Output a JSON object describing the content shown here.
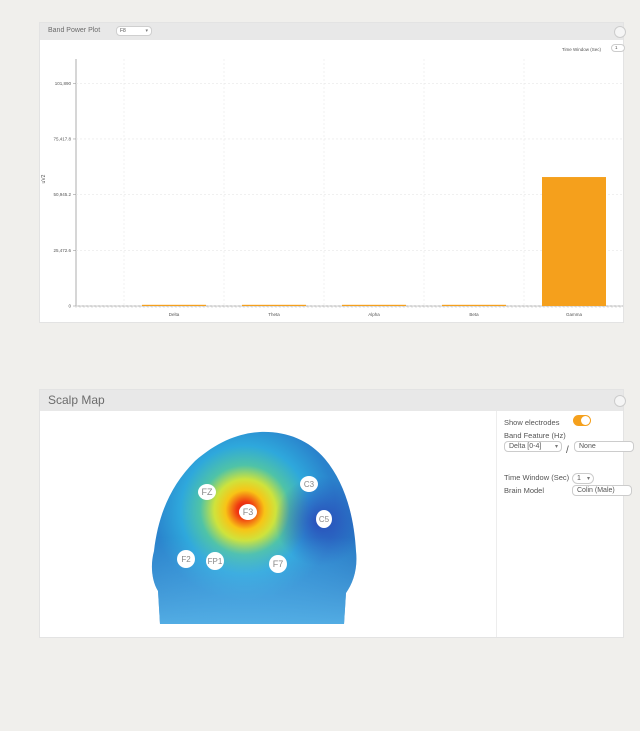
{
  "band_panel": {
    "title": "Band Power Plot",
    "channel_select": "F8",
    "time_window_label": "Time Window (Sec)",
    "time_window_value": "1"
  },
  "chart_data": {
    "type": "bar",
    "categories": [
      "Delta",
      "Theta",
      "Alpha",
      "Beta",
      "Gamma"
    ],
    "values": [
      200,
      200,
      200,
      150,
      59000
    ],
    "ylabel": "uV2",
    "ylim": [
      0,
      113000
    ],
    "yticks": [
      0,
      25472.6,
      50945.2,
      76417.8,
      101890
    ],
    "ytick_labels": [
      "0",
      "25,472.6",
      "50,945.2",
      "75,417.8",
      "101,890"
    ],
    "grid": true,
    "bar_color": "#f5a01c"
  },
  "scalp_panel": {
    "title": "Scalp Map",
    "show_electrodes_label": "Show electrodes",
    "show_electrodes_on": true,
    "band_feature_label": "Band Feature (Hz)",
    "band_feature_value": "Delta [0-4]",
    "band_feature_value2": "None",
    "time_window_label": "Time Window (Sec)",
    "time_window_value": "1",
    "brain_model_label": "Brain Model",
    "brain_model_value": "Colin (Male)",
    "electrodes": [
      "FZ",
      "F3",
      "C3",
      "C5",
      "F7",
      "FP1",
      "F2"
    ]
  }
}
